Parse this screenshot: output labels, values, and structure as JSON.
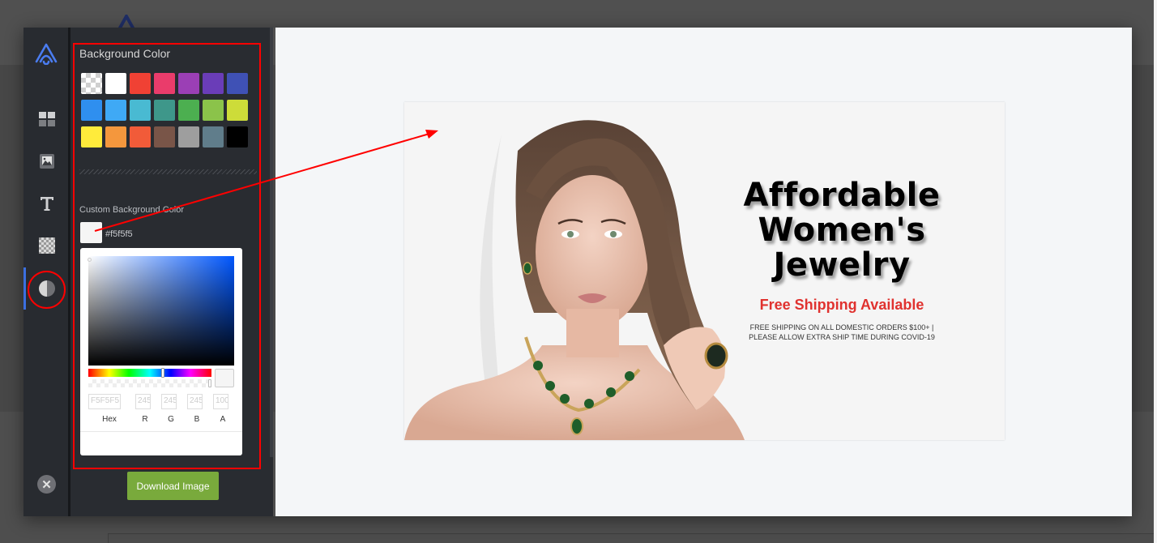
{
  "rail": {
    "items": [
      {
        "name": "layouts",
        "icon": "grid-icon"
      },
      {
        "name": "images",
        "icon": "image-icon"
      },
      {
        "name": "text",
        "icon": "text-icon"
      },
      {
        "name": "overlay",
        "icon": "checkerboard-icon"
      },
      {
        "name": "background-color",
        "icon": "contrast-icon",
        "active": true
      }
    ],
    "close_icon": "close-icon"
  },
  "panel": {
    "title": "Background Color",
    "swatches": [
      "transparent",
      "#ffffff",
      "#f04134",
      "#ea3c6b",
      "#9b3fb5",
      "#6a3db8",
      "#3f51b5",
      "#2f8fef",
      "#3fa9f5",
      "#49bad2",
      "#3e978a",
      "#4caf50",
      "#8bc34a",
      "#cddc39",
      "#ffeb3b",
      "#f4973d",
      "#f15b39",
      "#795548",
      "#9e9e9e",
      "#607d8b",
      "#000000"
    ],
    "custom_label": "Custom Background Color",
    "custom_value": "#f5f5f5",
    "custom_hex_text": "#f5f5f5",
    "picker": {
      "hex": "F5F5F5",
      "r": "245",
      "g": "245",
      "b": "245",
      "a": "100",
      "labels": {
        "hex": "Hex",
        "r": "R",
        "g": "G",
        "b": "B",
        "a": "A"
      }
    },
    "download_label": "Download Image"
  },
  "canvas": {
    "background": "#f5f5f5",
    "headline_lines": [
      "Affordable",
      "Women's",
      "Jewelry"
    ],
    "subhead": "Free Shipping Available",
    "fine_print_lines": [
      "FREE SHIPPING ON ALL DOMESTIC ORDERS $100+  |",
      "PLEASE ALLOW EXTRA SHIP TIME DURING COVID-19"
    ],
    "image_alt": "woman wearing emerald necklace, earrings and ring"
  },
  "annotations": {
    "color": "#ff0000"
  }
}
